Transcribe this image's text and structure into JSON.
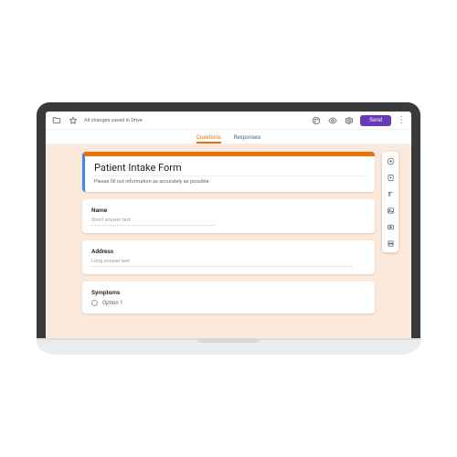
{
  "topbar": {
    "status": "All changes saved in Drive",
    "send_label": "Send"
  },
  "tabs": {
    "questions": "Questions",
    "responses": "Responses"
  },
  "form": {
    "title": "Patient Intake Form",
    "description": "Please fill out information as accurately as possible"
  },
  "questions": {
    "q1": {
      "label": "Name",
      "placeholder": "Short answer text"
    },
    "q2": {
      "label": "Address",
      "placeholder": "Long answer text"
    },
    "q3": {
      "label": "Symptoms",
      "option1": "Option 1"
    }
  },
  "side_tooltips": {
    "add": "Add question",
    "import": "Import questions",
    "title": "Add title and description",
    "image": "Add image",
    "video": "Add video",
    "section": "Add section"
  }
}
